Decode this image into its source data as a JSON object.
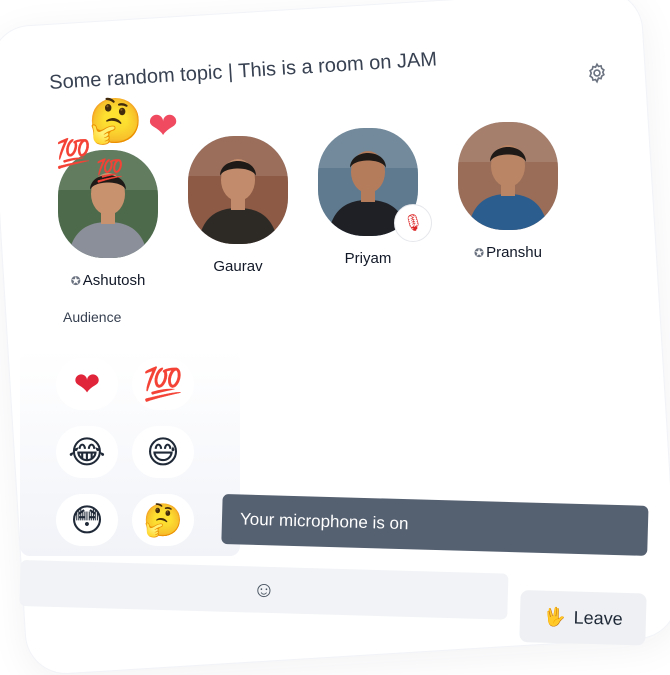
{
  "room": {
    "topic": "Some random topic | This is a room on JAM"
  },
  "icons": {
    "settings": "⚙",
    "moderator": "✪",
    "muted": "🎙",
    "emoji": "☺"
  },
  "speakers": [
    {
      "name": "Ashutosh",
      "moderator": true,
      "muted": false,
      "skin": "#c9926e",
      "shirt": "#8a8f99",
      "bg": "#4d6a4a"
    },
    {
      "name": "Gaurav",
      "moderator": false,
      "muted": false,
      "skin": "#c28c6c",
      "shirt": "#2d2a26",
      "bg": "#8c5a45"
    },
    {
      "name": "Priyam",
      "moderator": false,
      "muted": true,
      "skin": "#b57c5c",
      "shirt": "#1f2026",
      "bg": "#5f7a8e"
    },
    {
      "name": "Pranshu",
      "moderator": true,
      "muted": false,
      "skin": "#b98565",
      "shirt": "#2b5d8e",
      "bg": "#9a6d58"
    }
  ],
  "floating_reactions": [
    "🤔",
    "❤",
    "💯",
    "💯"
  ],
  "audience_label": "Audience",
  "reactions": [
    "❤",
    "💯",
    "😂",
    "😅",
    "😳",
    "🤔"
  ],
  "mic_status": "Your microphone is on",
  "leave": {
    "icon": "🖖",
    "label": "Leave"
  }
}
